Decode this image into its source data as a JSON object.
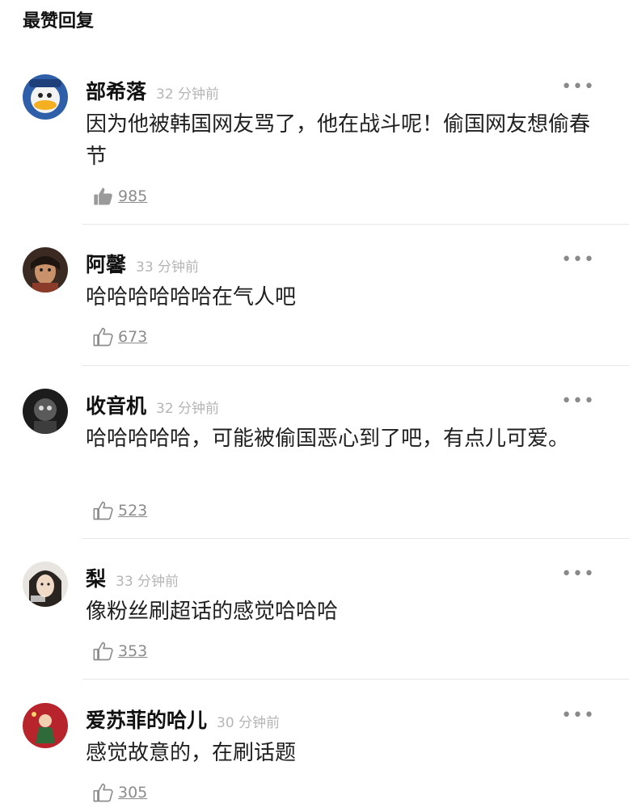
{
  "section_title": "最赞回复",
  "more_label": "•••",
  "comments": [
    {
      "name": "部希落",
      "time": "32 分钟前",
      "text": "因为他被韩国网友骂了，他在战斗呢！偷国网友想偷春节",
      "likes": "985",
      "liked": true,
      "avatar": "avatar-donald-duck"
    },
    {
      "name": "阿馨",
      "time": "33 分钟前",
      "text": "哈哈哈哈哈哈在气人吧",
      "likes": "673",
      "liked": false,
      "avatar": "avatar-portrait"
    },
    {
      "name": "收音机",
      "time": "32 分钟前",
      "text": "哈哈哈哈哈，可能被偷国恶心到了吧，有点儿可爱。",
      "likes": "523",
      "liked": false,
      "avatar": "avatar-dark-figure"
    },
    {
      "name": "梨",
      "time": "33 分钟前",
      "text": "像粉丝刷超话的感觉哈哈哈",
      "likes": "353",
      "liked": false,
      "avatar": "avatar-girl"
    },
    {
      "name": "爱苏菲的哈儿",
      "time": "30 分钟前",
      "text": "感觉故意的，在刷话题",
      "likes": "305",
      "liked": false,
      "avatar": "avatar-red-illustration"
    }
  ],
  "icons": {
    "like": "thumbs-up-icon",
    "more": "more-dots-icon"
  },
  "colors": {
    "time": "#b5b5b5",
    "like_count": "#8c8c8c",
    "divider": "#e6e6e6"
  }
}
